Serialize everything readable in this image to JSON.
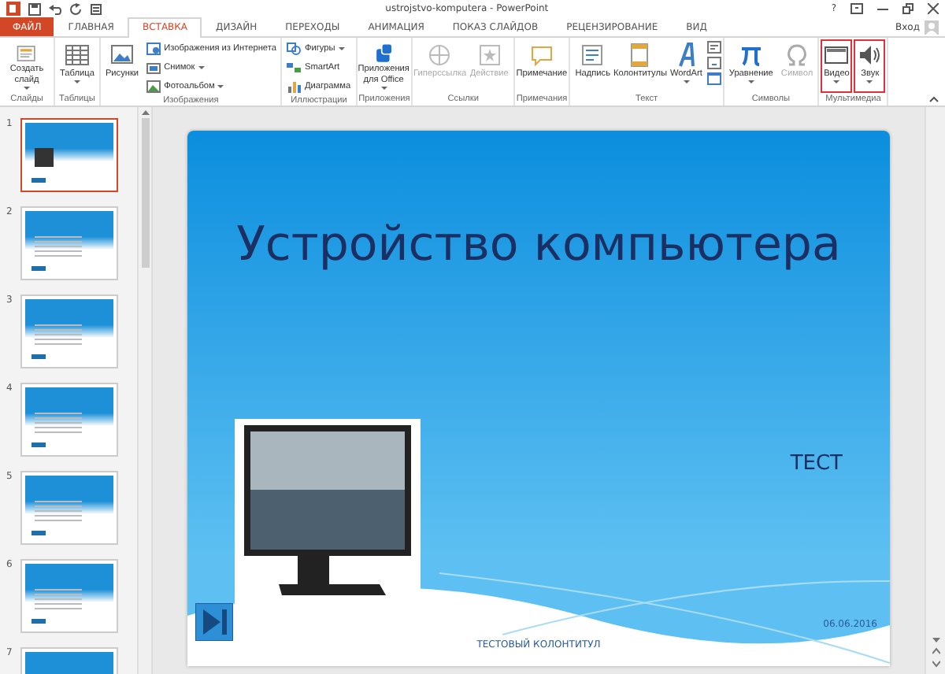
{
  "window": {
    "title": "ustrojstvo-komputera - PowerPoint",
    "help": "?",
    "sign_in": "Вход"
  },
  "tabs": [
    {
      "label": "ФАЙЛ",
      "kind": "file",
      "selected": false
    },
    {
      "label": "ГЛАВНАЯ",
      "kind": "tab",
      "selected": false
    },
    {
      "label": "ВСТАВКА",
      "kind": "tab",
      "selected": true
    },
    {
      "label": "ДИЗАЙН",
      "kind": "tab",
      "selected": false
    },
    {
      "label": "ПЕРЕХОДЫ",
      "kind": "tab",
      "selected": false
    },
    {
      "label": "АНИМАЦИЯ",
      "kind": "tab",
      "selected": false
    },
    {
      "label": "ПОКАЗ СЛАЙДОВ",
      "kind": "tab",
      "selected": false
    },
    {
      "label": "РЕЦЕНЗИРОВАНИЕ",
      "kind": "tab",
      "selected": false
    },
    {
      "label": "ВИД",
      "kind": "tab",
      "selected": false
    }
  ],
  "ribbon": {
    "groups": [
      {
        "label": "Слайды",
        "commands": [
          {
            "label": "Создать слайд",
            "kind": "large",
            "dropdown": true,
            "disabled": false,
            "highlighted": false
          }
        ]
      },
      {
        "label": "Таблицы",
        "commands": [
          {
            "label": "Таблица",
            "kind": "large",
            "dropdown": true,
            "disabled": false,
            "highlighted": false
          }
        ]
      },
      {
        "label": "Изображения",
        "commands": [
          {
            "label": "Рисунки",
            "kind": "large",
            "dropdown": false,
            "disabled": false,
            "highlighted": false
          },
          {
            "label": "Изображения из Интернета",
            "kind": "small",
            "dropdown": false,
            "disabled": false,
            "highlighted": false
          },
          {
            "label": "Снимок",
            "kind": "small",
            "dropdown": true,
            "disabled": false,
            "highlighted": false
          },
          {
            "label": "Фотоальбом",
            "kind": "small",
            "dropdown": true,
            "disabled": false,
            "highlighted": false
          }
        ]
      },
      {
        "label": "Иллюстрации",
        "commands": [
          {
            "label": "Фигуры",
            "kind": "small",
            "dropdown": true,
            "disabled": false,
            "highlighted": false
          },
          {
            "label": "SmartArt",
            "kind": "small",
            "dropdown": false,
            "disabled": false,
            "highlighted": false
          },
          {
            "label": "Диаграмма",
            "kind": "small",
            "dropdown": false,
            "disabled": false,
            "highlighted": false
          }
        ]
      },
      {
        "label": "Приложения",
        "commands": [
          {
            "label": "Приложения для Office",
            "kind": "large",
            "dropdown": true,
            "disabled": false,
            "highlighted": false
          }
        ]
      },
      {
        "label": "Ссылки",
        "commands": [
          {
            "label": "Гиперссылка",
            "kind": "large",
            "dropdown": false,
            "disabled": true,
            "highlighted": false
          },
          {
            "label": "Действие",
            "kind": "large",
            "dropdown": false,
            "disabled": true,
            "highlighted": false
          }
        ]
      },
      {
        "label": "Примечания",
        "commands": [
          {
            "label": "Примечание",
            "kind": "large",
            "dropdown": false,
            "disabled": false,
            "highlighted": false
          }
        ]
      },
      {
        "label": "Текст",
        "commands": [
          {
            "label": "Надпись",
            "kind": "large",
            "dropdown": false,
            "disabled": false,
            "highlighted": false
          },
          {
            "label": "Колонтитулы",
            "kind": "large",
            "dropdown": false,
            "disabled": false,
            "highlighted": false
          },
          {
            "label": "WordArt",
            "kind": "large",
            "dropdown": true,
            "disabled": false,
            "highlighted": false
          }
        ]
      },
      {
        "label": "Символы",
        "commands": [
          {
            "label": "Уравнение",
            "kind": "large",
            "dropdown": true,
            "disabled": false,
            "highlighted": false
          },
          {
            "label": "Символ",
            "kind": "large",
            "dropdown": false,
            "disabled": true,
            "highlighted": false
          }
        ]
      },
      {
        "label": "Мультимедиа",
        "commands": [
          {
            "label": "Видео",
            "kind": "large",
            "dropdown": true,
            "disabled": false,
            "highlighted": true
          },
          {
            "label": "Звук",
            "kind": "large",
            "dropdown": true,
            "disabled": false,
            "highlighted": true
          }
        ]
      }
    ]
  },
  "thumbnails": [
    {
      "number": "1",
      "selected": true
    },
    {
      "number": "2",
      "selected": false
    },
    {
      "number": "3",
      "selected": false
    },
    {
      "number": "4",
      "selected": false
    },
    {
      "number": "5",
      "selected": false
    },
    {
      "number": "6",
      "selected": false
    },
    {
      "number": "7",
      "selected": false
    }
  ],
  "slide": {
    "title": "Устройство компьютера",
    "subtitle": "ТЕСТ",
    "footer": "ТЕСТОВЫЙ КОЛОНТИТУЛ",
    "date": "06.06.2016"
  }
}
